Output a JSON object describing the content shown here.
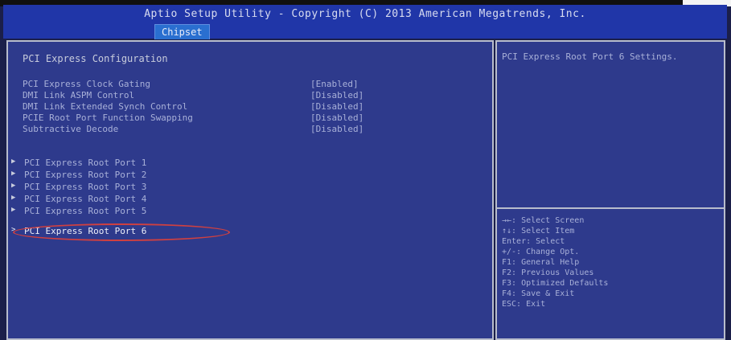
{
  "header": {
    "title": "Aptio Setup Utility - Copyright (C) 2013 American Megatrends, Inc.",
    "active_tab": "Chipset"
  },
  "main": {
    "section_title": "PCI Express Configuration",
    "settings": [
      {
        "label": "PCI Express Clock Gating",
        "value": "[Enabled]"
      },
      {
        "label": "DMI Link ASPM Control",
        "value": "[Disabled]"
      },
      {
        "label": "DMI Link Extended Synch Control",
        "value": "[Disabled]"
      },
      {
        "label": "PCIE Root Port Function Swapping",
        "value": "[Disabled]"
      },
      {
        "label": "Subtractive Decode",
        "value": "[Disabled]"
      }
    ],
    "submenus": [
      {
        "label": "PCI Express Root Port 1",
        "arrow": "▶"
      },
      {
        "label": "PCI Express Root Port 2",
        "arrow": "▶"
      },
      {
        "label": "PCI Express Root Port 3",
        "arrow": "▶"
      },
      {
        "label": "PCI Express Root Port 4",
        "arrow": "▶"
      },
      {
        "label": "PCI Express Root Port 5",
        "arrow": "▶"
      },
      {
        "label": "PCI Express Root Port 6",
        "arrow": ">"
      }
    ]
  },
  "help": {
    "text": "PCI Express Root Port 6 Settings."
  },
  "keys": [
    "→←: Select Screen",
    "↑↓: Select Item",
    "Enter: Select",
    "+/-: Change Opt.",
    "F1: General Help",
    "F2: Previous Values",
    "F3: Optimized Defaults",
    "F4: Save & Exit",
    "ESC: Exit"
  ],
  "colors": {
    "header_bg": "#2036a8",
    "panel_bg": "#2e3a8c",
    "border": "#b8bccc",
    "text": "#a8b0d8",
    "highlight_circle": "#d04040"
  }
}
